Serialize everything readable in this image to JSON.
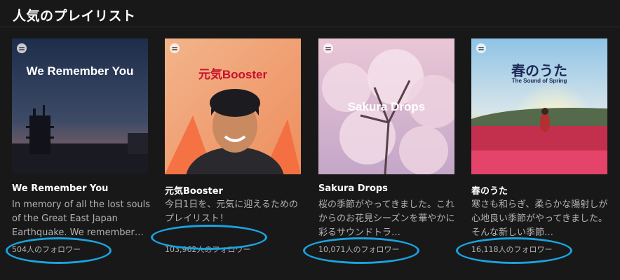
{
  "section": {
    "title": "人気のプレイリスト"
  },
  "playlists": [
    {
      "cover_title": "We Remember You",
      "title": "We Remember You",
      "description": "In memory of all the lost souls of the Great East Japan Earthquake. We remember…",
      "followers": "504人のフォロワー"
    },
    {
      "cover_title": "元気Booster",
      "title": "元気Booster",
      "description": "今日1日を、元気に迎えるためのプレイリスト！",
      "followers": "103,962人のフォロワー"
    },
    {
      "cover_title": "Sakura Drops",
      "title": "Sakura Drops",
      "description": "桜の季節がやってきました。これからのお花見シーズンを華やかに彩るサウンドトラ…",
      "followers": "10,071人のフォロワー"
    },
    {
      "cover_title": "春のうた",
      "cover_subtitle": "The Sound of Spring",
      "title": "春のうた",
      "description": "寒さも和らぎ、柔らかな陽射しが心地良い季節がやってきました。そんな新しい季節…",
      "followers": "16,118人のフォロワー"
    }
  ],
  "colors": {
    "background": "#181818",
    "text_primary": "#ffffff",
    "text_secondary": "#b3b3b3",
    "annotation": "#1aa3e0"
  }
}
